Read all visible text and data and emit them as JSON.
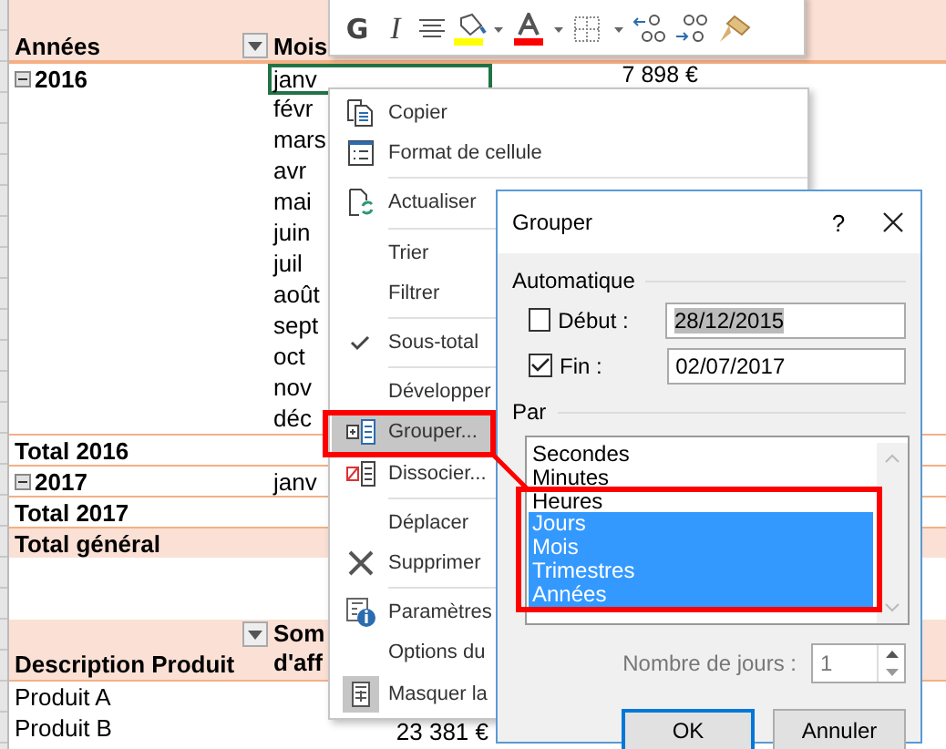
{
  "sheet": {
    "header": {
      "col_a": "Années",
      "col_b": "Mois"
    },
    "rows": [
      {
        "kind": "group",
        "a": "2016",
        "b": "janv",
        "c": "7 898 €",
        "expanded": true,
        "selected": true
      },
      {
        "kind": "item",
        "b": "févr",
        "selected": false
      },
      {
        "kind": "item",
        "b": "mars",
        "selected": false
      },
      {
        "kind": "item",
        "b": "avr",
        "selected": false
      },
      {
        "kind": "item",
        "b": "mai",
        "selected": false
      },
      {
        "kind": "item",
        "b": "juin",
        "selected": false
      },
      {
        "kind": "item",
        "b": "juil",
        "selected": false
      },
      {
        "kind": "item",
        "b": "août",
        "selected": false
      },
      {
        "kind": "item",
        "b": "sept",
        "selected": false
      },
      {
        "kind": "item",
        "b": "oct",
        "selected": false
      },
      {
        "kind": "item",
        "b": "nov",
        "selected": false
      },
      {
        "kind": "item",
        "b": "déc",
        "selected": false
      },
      {
        "kind": "total",
        "a": "Total 2016",
        "selected": false
      },
      {
        "kind": "group",
        "a": "2017",
        "b": "janv",
        "expanded": true,
        "selected": false
      },
      {
        "kind": "total",
        "a": "Total 2017",
        "selected": false
      },
      {
        "kind": "grand",
        "a": "Total général",
        "selected": false
      },
      {
        "kind": "blank",
        "selected": false
      },
      {
        "kind": "blank",
        "selected": false
      },
      {
        "kind": "header2",
        "a": "Description Produit",
        "b_lines": [
          "Som",
          "d'aff"
        ],
        "selected": false
      },
      {
        "kind": "item",
        "a": "Produit A",
        "selected": false
      },
      {
        "kind": "item",
        "a": "Produit B",
        "b_value": "23 381 €",
        "selected": false
      }
    ]
  },
  "toolbar": {
    "bold": "G",
    "italic": "I"
  },
  "menu": {
    "items": [
      {
        "label": "Copier",
        "separator_before": false,
        "checked": false,
        "selected": false
      },
      {
        "label": "Format de cellule",
        "separator_before": false,
        "checked": false,
        "selected": false
      },
      {
        "label": "Actualiser",
        "separator_before": true,
        "checked": false,
        "selected": false
      },
      {
        "label": "Trier",
        "separator_before": true,
        "checked": false,
        "selected": false
      },
      {
        "label": "Filtrer",
        "separator_before": false,
        "checked": false,
        "selected": false
      },
      {
        "label": "Sous-total",
        "separator_before": true,
        "checked": true,
        "selected": false
      },
      {
        "label": "Développer",
        "separator_before": true,
        "checked": false,
        "selected": false
      },
      {
        "label": "Grouper...",
        "separator_before": false,
        "checked": false,
        "selected": true
      },
      {
        "label": "Dissocier...",
        "separator_before": false,
        "checked": false,
        "selected": false
      },
      {
        "label": "Déplacer",
        "separator_before": true,
        "checked": false,
        "selected": false
      },
      {
        "label": "Supprimer",
        "separator_before": false,
        "checked": false,
        "selected": false
      },
      {
        "label": "Paramètres",
        "separator_before": true,
        "checked": false,
        "selected": false
      },
      {
        "label": "Options du",
        "separator_before": false,
        "checked": false,
        "selected": false
      },
      {
        "label": "Masquer la",
        "separator_before": false,
        "checked": false,
        "selected": false
      }
    ]
  },
  "dialog": {
    "title": "Grouper",
    "help": "?",
    "auto_section": "Automatique",
    "start": {
      "label": "Début :",
      "checked": false,
      "value": "28/12/2015",
      "text_selected": true
    },
    "end": {
      "label": "Fin :",
      "checked": true,
      "value": "02/07/2017",
      "text_selected": false
    },
    "by_section": "Par",
    "list": [
      {
        "label": "Secondes",
        "selected": false
      },
      {
        "label": "Minutes",
        "selected": false
      },
      {
        "label": "Heures",
        "selected": false
      },
      {
        "label": "Jours",
        "selected": true
      },
      {
        "label": "Mois",
        "selected": true
      },
      {
        "label": "Trimestres",
        "selected": true
      },
      {
        "label": "Années",
        "selected": true
      }
    ],
    "days": {
      "label": "Nombre de jours :",
      "value": "1",
      "disabled": true
    },
    "buttons": [
      {
        "label": "OK",
        "default": true
      },
      {
        "label": "Annuler",
        "default": false
      }
    ]
  }
}
